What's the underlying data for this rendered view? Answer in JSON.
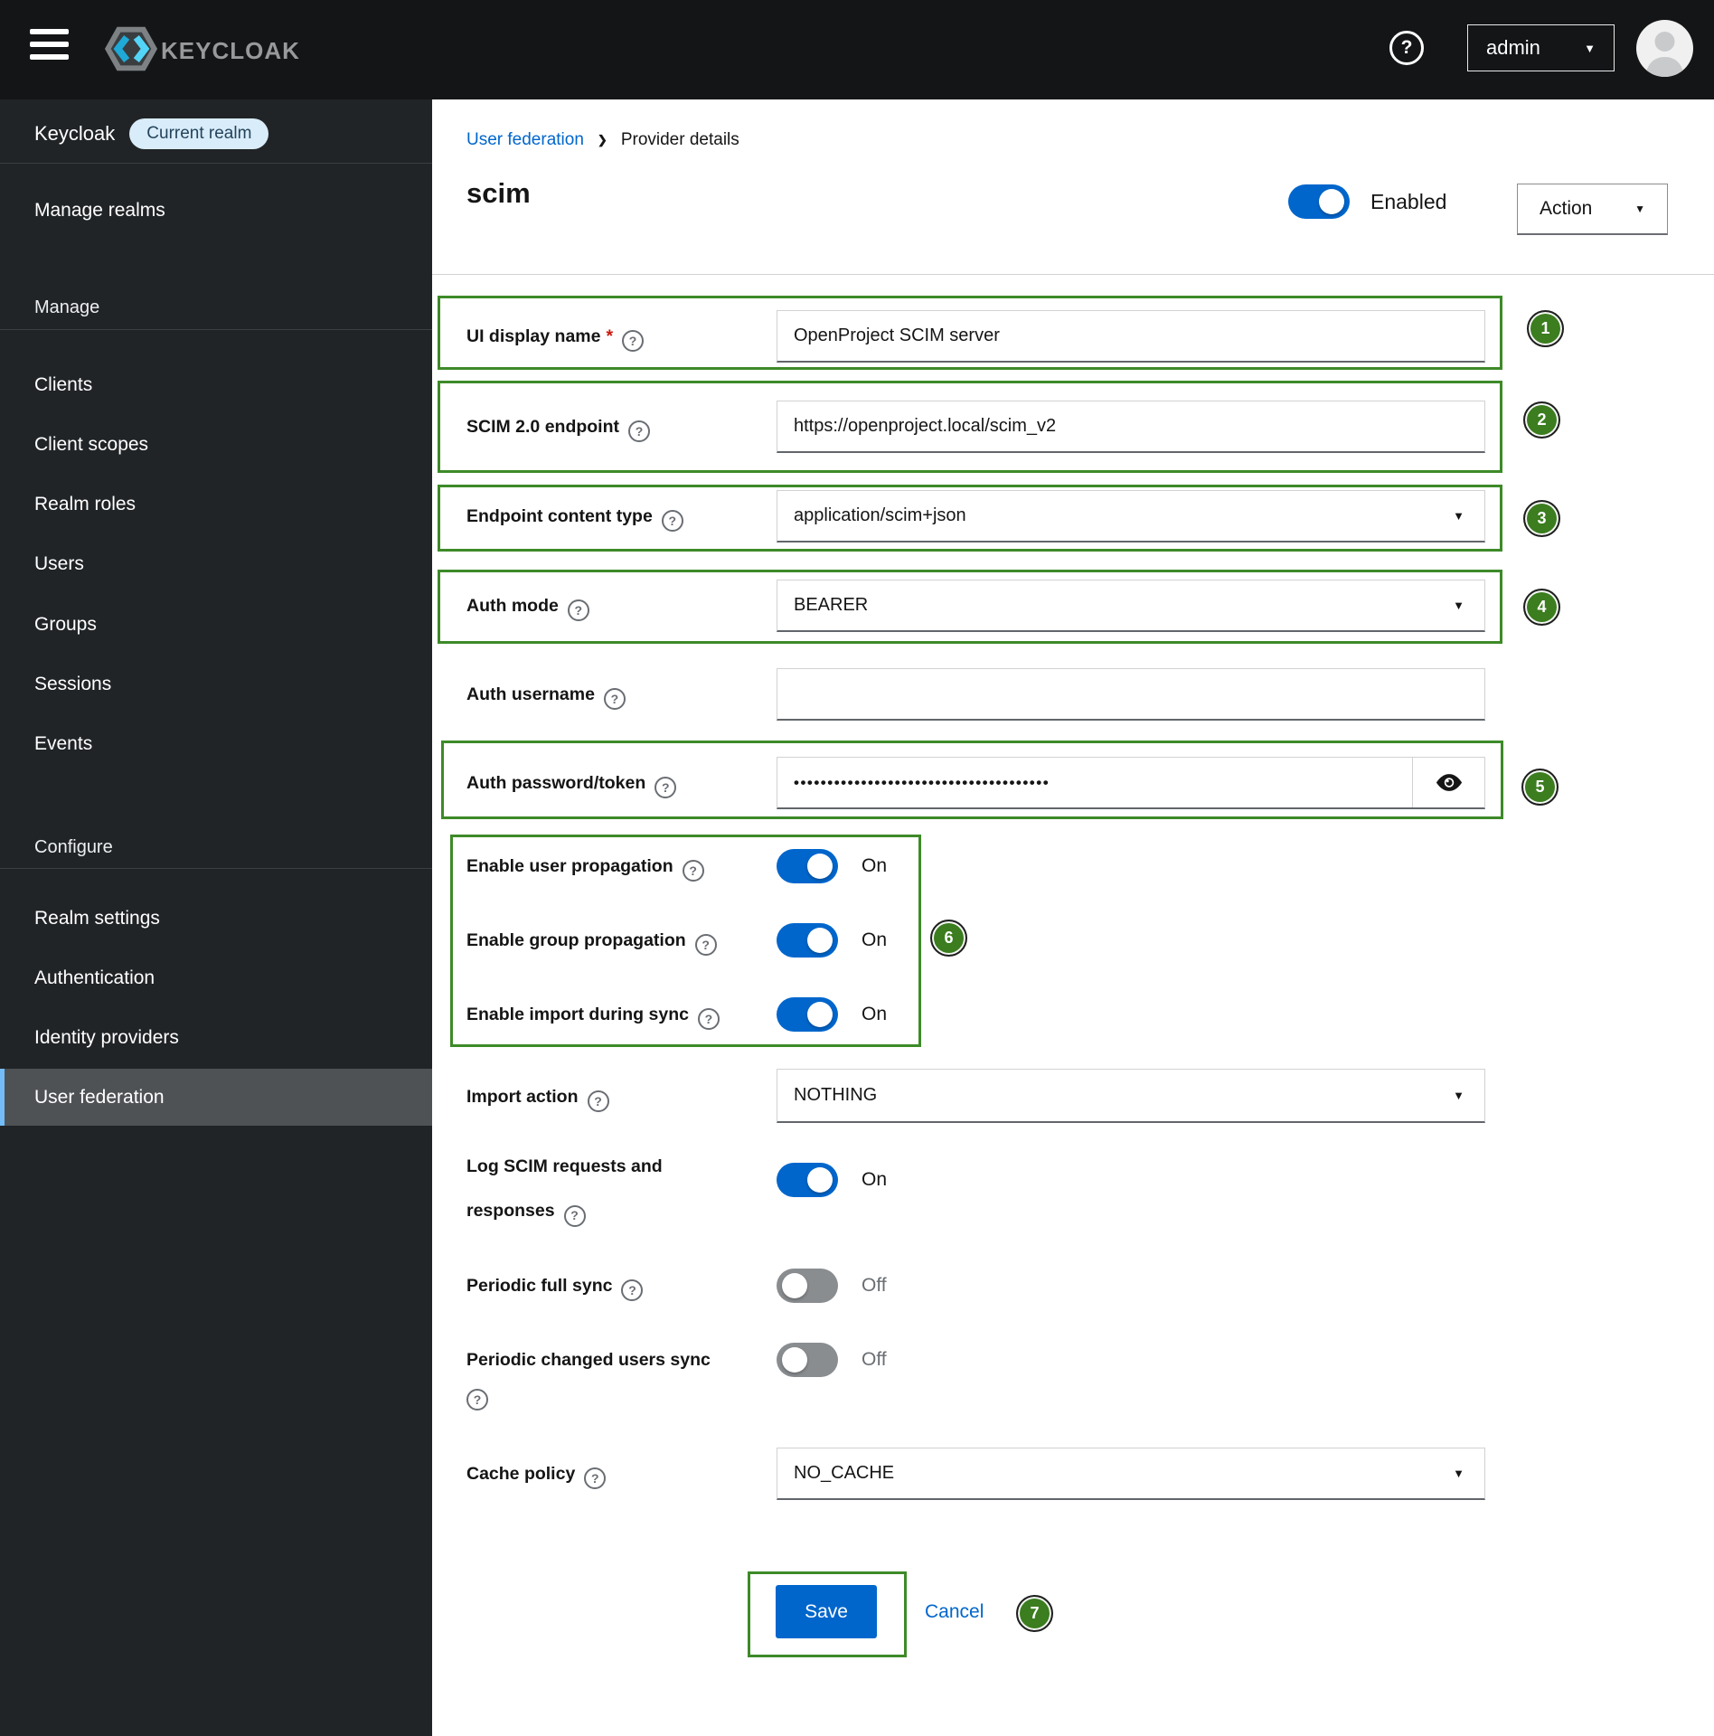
{
  "icons": {
    "help_glyph": "?",
    "caret_down": "▼",
    "breadcrumb_separator": "❯"
  },
  "colors": {
    "primary_blue": "#0066cc",
    "annotation_green": "#3d8a28",
    "badge_green": "#3b7d1f",
    "toggle_off_gray": "#8a8d90",
    "selected_item_accent": "#73bcf7"
  },
  "header": {
    "logo_text": "KEYCLOAK",
    "user_menu_label": "admin"
  },
  "sidebar": {
    "realm_name": "Keycloak",
    "realm_badge": "Current realm",
    "manage_realms_label": "Manage realms",
    "sections": [
      {
        "title": "Manage",
        "items": [
          {
            "label": "Clients"
          },
          {
            "label": "Client scopes"
          },
          {
            "label": "Realm roles"
          },
          {
            "label": "Users"
          },
          {
            "label": "Groups"
          },
          {
            "label": "Sessions"
          },
          {
            "label": "Events"
          }
        ]
      },
      {
        "title": "Configure",
        "items": [
          {
            "label": "Realm settings"
          },
          {
            "label": "Authentication"
          },
          {
            "label": "Identity providers"
          },
          {
            "label": "User federation",
            "selected": true
          }
        ]
      }
    ]
  },
  "breadcrumb": {
    "link": "User federation",
    "current": "Provider details"
  },
  "page": {
    "title": "scim",
    "enabled_label": "Enabled",
    "enabled_state": "on",
    "action_label": "Action"
  },
  "form": {
    "fields": [
      {
        "label": "UI display name",
        "required_mark": "*",
        "control": {
          "type": "text",
          "value": "OpenProject SCIM server"
        },
        "annotation": "1"
      },
      {
        "label": "SCIM 2.0 endpoint",
        "control": {
          "type": "text",
          "value": "https://openproject.local/scim_v2"
        },
        "annotation": "2"
      },
      {
        "label": "Endpoint content type",
        "control": {
          "type": "select",
          "value": "application/scim+json"
        },
        "annotation": "3"
      },
      {
        "label": "Auth mode",
        "control": {
          "type": "select",
          "value": "BEARER"
        },
        "annotation": "4"
      },
      {
        "label": "Auth username",
        "control": {
          "type": "text",
          "value": ""
        }
      },
      {
        "label": "Auth password/token",
        "control": {
          "type": "password",
          "value": "••••••••••••••••••••••••••••••••••••••"
        },
        "annotation": "5"
      },
      {
        "label": "Enable user propagation",
        "control": {
          "type": "toggle",
          "state": "On"
        }
      },
      {
        "label": "Enable group propagation",
        "control": {
          "type": "toggle",
          "state": "On"
        },
        "annotation": "6"
      },
      {
        "label": "Enable import during sync",
        "control": {
          "type": "toggle",
          "state": "On"
        }
      },
      {
        "label": "Import action",
        "control": {
          "type": "select",
          "value": "NOTHING"
        }
      },
      {
        "label": "Log SCIM requests and responses",
        "control": {
          "type": "toggle",
          "state": "On"
        }
      },
      {
        "label": "Periodic full sync",
        "control": {
          "type": "toggle",
          "state": "Off"
        }
      },
      {
        "label": "Periodic changed users sync",
        "control": {
          "type": "toggle",
          "state": "Off"
        }
      },
      {
        "label": "Cache policy",
        "control": {
          "type": "select",
          "value": "NO_CACHE"
        }
      }
    ],
    "save_label": "Save",
    "cancel_label": "Cancel"
  },
  "annotations": {
    "badges": [
      "1",
      "2",
      "3",
      "4",
      "5",
      "6",
      "7"
    ]
  }
}
